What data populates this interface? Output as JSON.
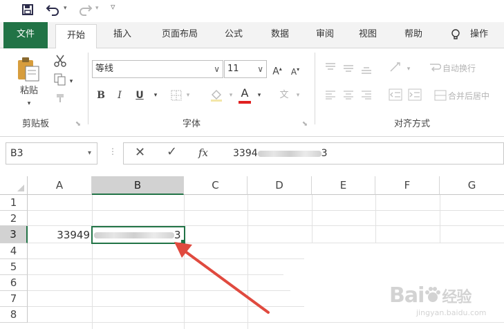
{
  "ribbon_tabs": {
    "file": "文件",
    "home": "开始",
    "insert": "插入",
    "page_layout": "页面布局",
    "formulas": "公式",
    "data": "数据",
    "review": "审阅",
    "view": "视图",
    "help": "帮助",
    "tell_me": "操作"
  },
  "clipboard": {
    "paste": "粘贴",
    "group": "剪贴板"
  },
  "font": {
    "name": "等线",
    "size": "11",
    "grow": "A",
    "shrink": "A",
    "bold": "B",
    "italic": "I",
    "underline": "U",
    "color_letter": "A",
    "wen": "文",
    "group": "字体"
  },
  "alignment": {
    "wrap_text": "自动换行",
    "merge_center": "合并后居中",
    "group": "对齐方式"
  },
  "formula_bar": {
    "name_box": "B3",
    "fx": "fx",
    "value_start": "3394",
    "value_end": "3"
  },
  "sheet": {
    "columns": [
      "A",
      "B",
      "C",
      "D",
      "E",
      "F",
      "G"
    ],
    "rows": [
      "1",
      "2",
      "3",
      "4",
      "5",
      "6",
      "7",
      "8"
    ],
    "a3_text": "33949",
    "b3_end": "3",
    "selected_cell": "B3"
  },
  "watermark": {
    "brand": "Bai",
    "brand2": "经验",
    "url": "jingyan.baidu.com"
  },
  "colors": {
    "excel_green": "#217346",
    "arrow_red": "#e04a3f"
  }
}
